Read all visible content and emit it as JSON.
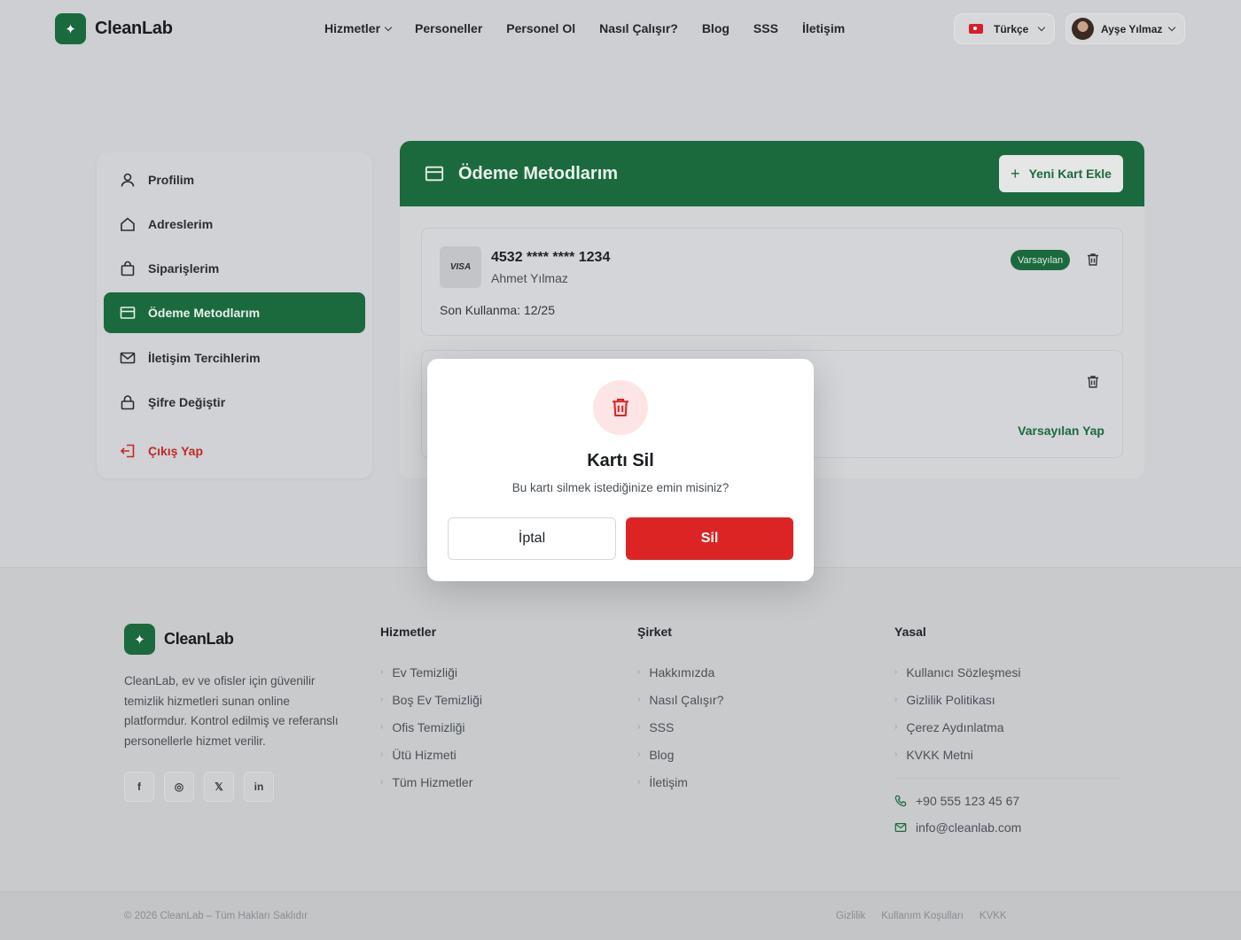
{
  "header": {
    "brand": "CleanLab",
    "nav": [
      "Hizmetler",
      "Personeller",
      "Personel Ol",
      "Nasıl Çalışır?",
      "Blog",
      "SSS",
      "İletişim"
    ],
    "language": "Türkçe",
    "user_name": "Ayşe Yılmaz"
  },
  "sidebar": {
    "items": [
      {
        "label": "Profilim",
        "icon": "user-icon"
      },
      {
        "label": "Adreslerim",
        "icon": "home-icon"
      },
      {
        "label": "Siparişlerim",
        "icon": "shopping-bag-icon"
      },
      {
        "label": "Ödeme Metodlarım",
        "icon": "credit-card-icon",
        "active": true
      },
      {
        "label": "İletişim Tercihlerim",
        "icon": "mail-icon"
      },
      {
        "label": "Şifre Değiştir",
        "icon": "lock-icon"
      },
      {
        "label": "Çıkış Yap",
        "icon": "logout-icon"
      }
    ]
  },
  "panel": {
    "title": "Ödeme Metodlarım",
    "add_button": "Yeni Kart Ekle",
    "cards": [
      {
        "brand": "VISA",
        "number": "4532 **** **** 1234",
        "holder": "Ahmet Yılmaz",
        "expiry": "Son Kullanma: 12/25",
        "badge": "Varsayılan"
      },
      {
        "make_default": "Varsayılan Yap"
      }
    ]
  },
  "modal": {
    "title": "Kartı Sil",
    "description": "Bu kartı silmek istediğinize emin misiniz?",
    "cancel": "İptal",
    "confirm": "Sil"
  },
  "footer": {
    "brand": "CleanLab",
    "description": "CleanLab, ev ve ofisler için güvenilir temizlik hizmetleri sunan online platformdur. Kontrol edilmiş ve referanslı personellerle hizmet verilir.",
    "socials": [
      "f",
      "◎",
      "𝕏",
      "in"
    ],
    "columns": [
      {
        "title": "Hizmetler",
        "links": [
          "Ev Temizliği",
          "Boş Ev Temizliği",
          "Ofis Temizliği",
          "Ütü Hizmeti",
          "Tüm Hizmetler"
        ]
      },
      {
        "title": "Şirket",
        "links": [
          "Hakkımızda",
          "Nasıl Çalışır?",
          "SSS",
          "Blog",
          "İletişim"
        ]
      },
      {
        "title": "Yasal",
        "links": [
          "Kullanıcı Sözleşmesi",
          "Gizlilik Politikası",
          "Çerez Aydınlatma",
          "KVKK Metni"
        ]
      }
    ],
    "phone": "+90 555 123 45 67",
    "email": "info@cleanlab.com",
    "copyright": "© 2026 CleanLab – Tüm Hakları Saklıdır",
    "bottom_links": [
      "Gizlilik",
      "Kullanım Koşulları",
      "KVKK"
    ]
  },
  "colors": {
    "brand": "#1b6a3e",
    "danger": "#dd2424"
  }
}
